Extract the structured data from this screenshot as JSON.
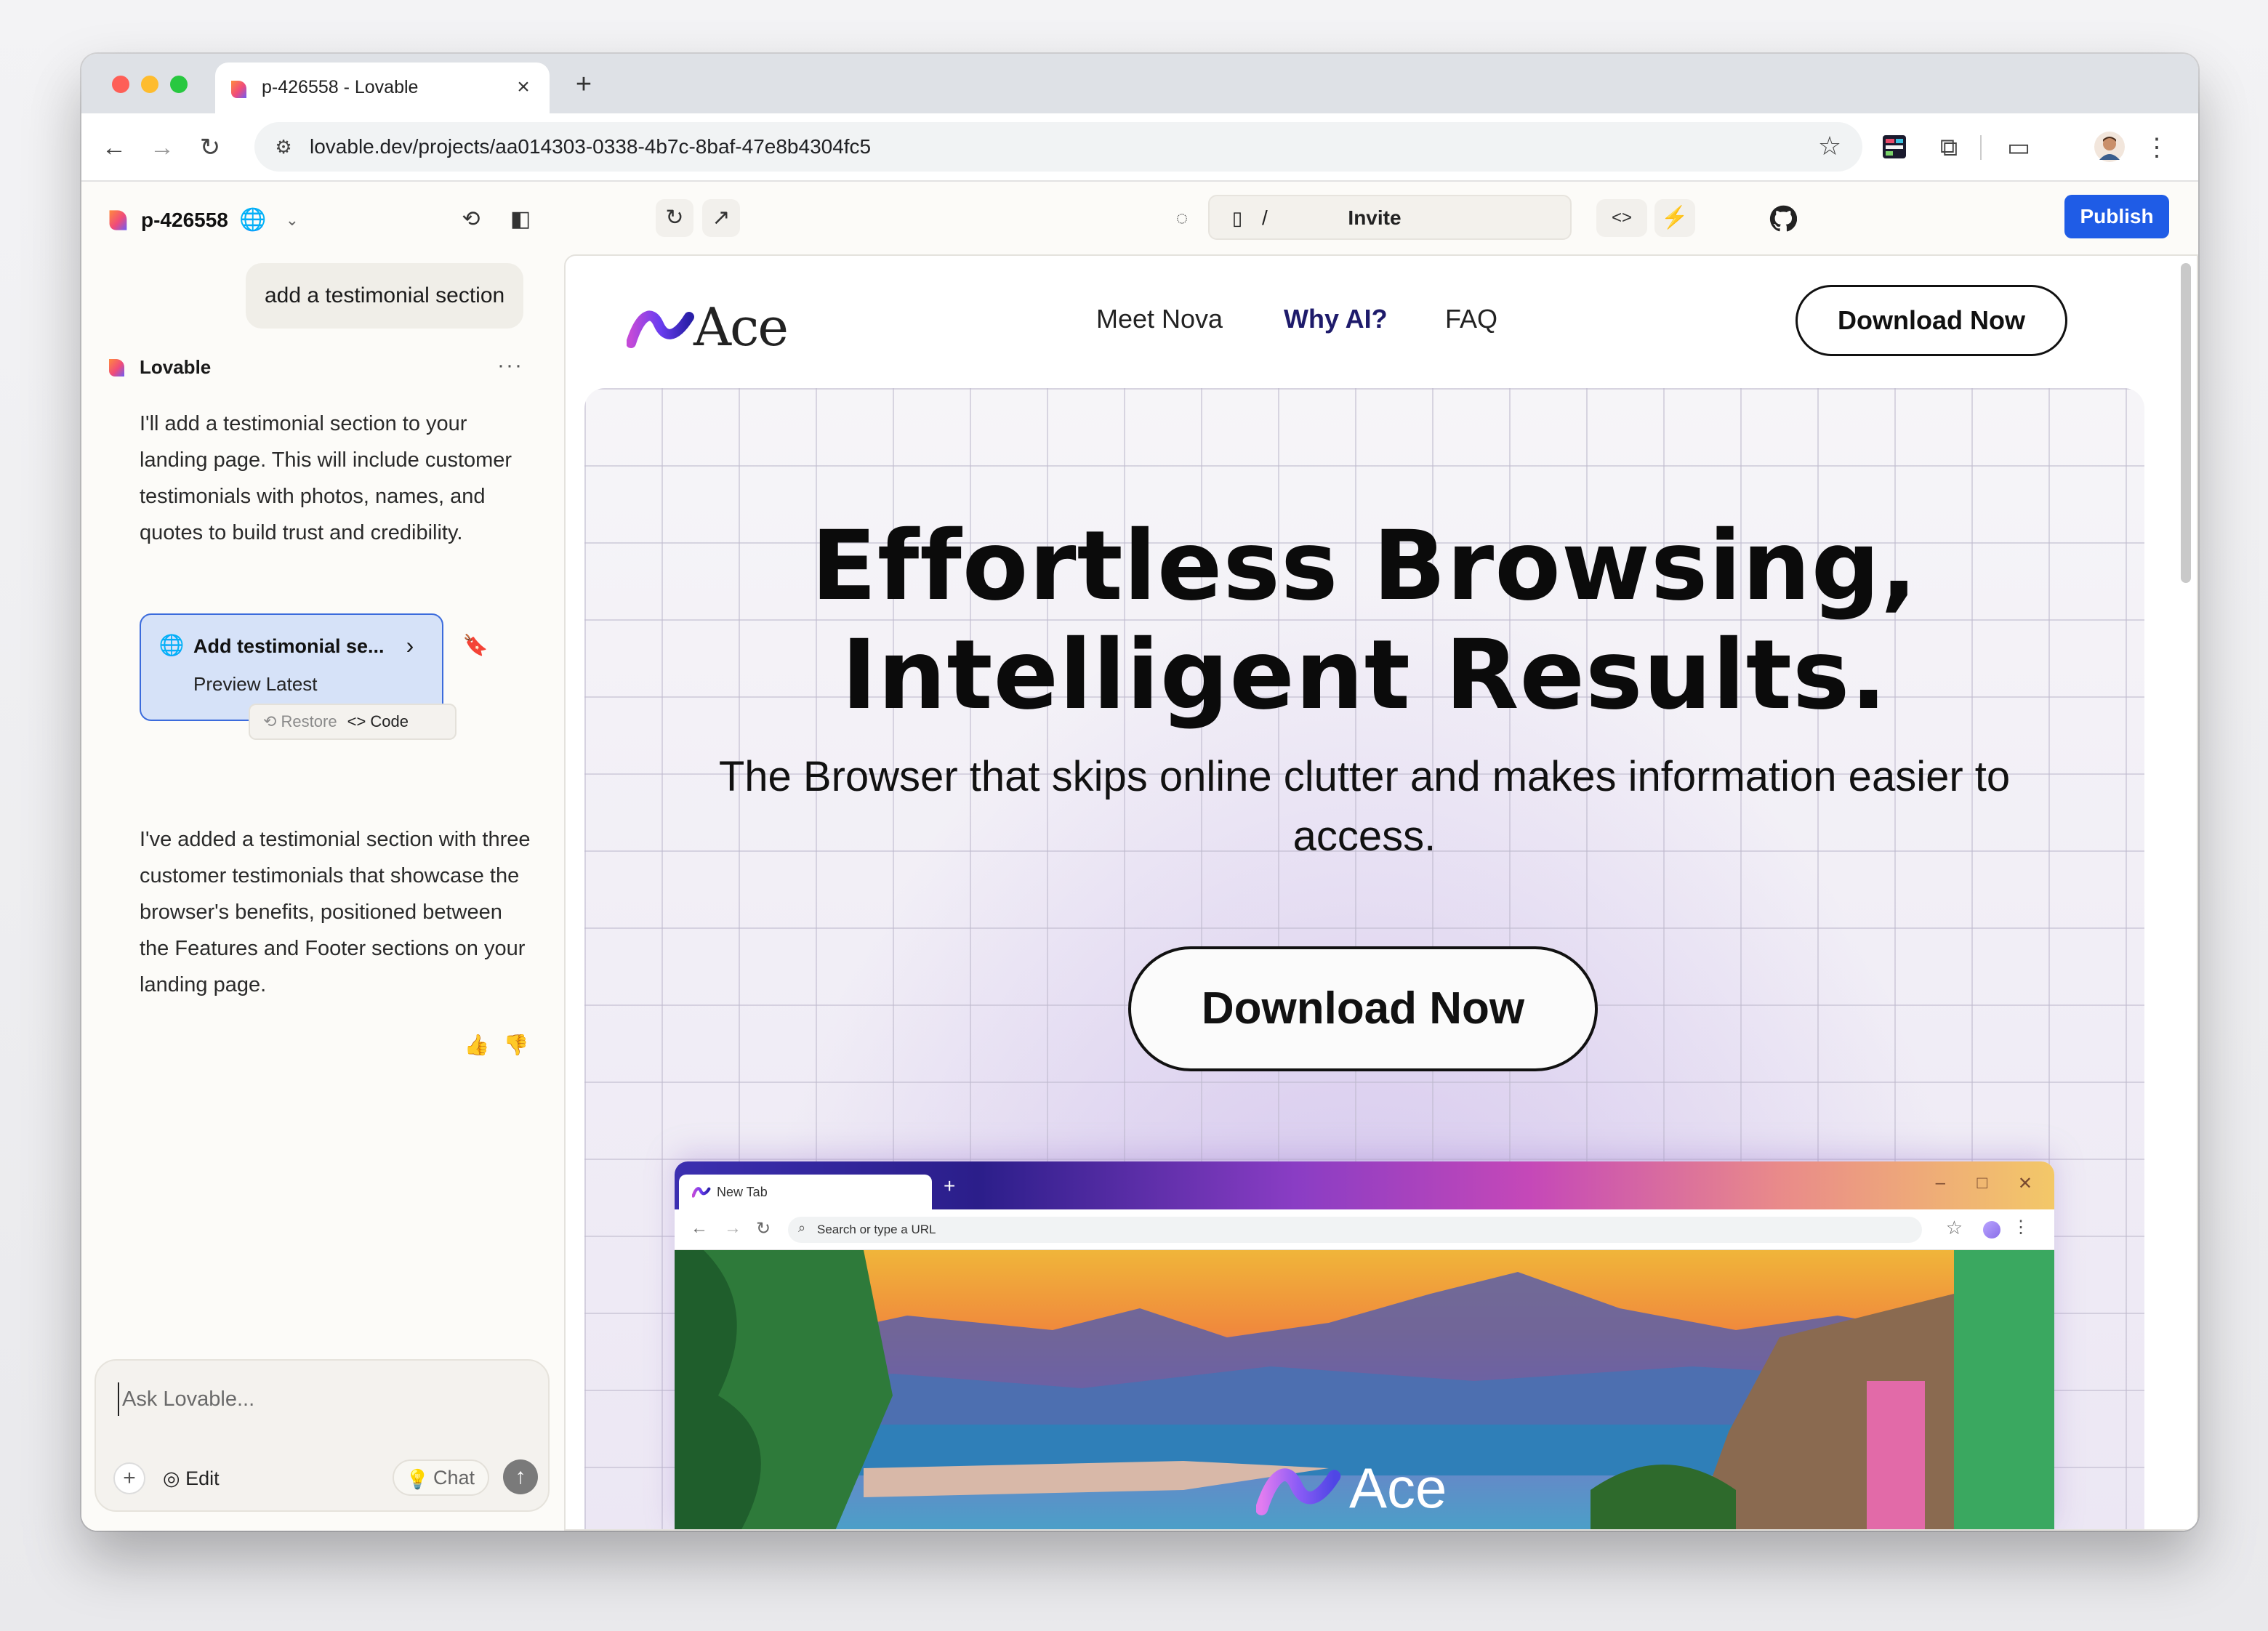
{
  "browser": {
    "tab_title": "p-426558 - Lovable",
    "tab_close": "×",
    "new_tab": "+",
    "url": "lovable.dev/projects/aa014303-0338-4b7c-8baf-47e8b4304fc5",
    "nav": {
      "back": "←",
      "forward": "→",
      "reload": "↻"
    },
    "menu": "⋮",
    "star": "☆"
  },
  "chat": {
    "project_name": "p-426558",
    "user_message": "add a testimonial section",
    "assistant_name": "Lovable",
    "more": "···",
    "reply_1": "I'll add a testimonial section to your landing page. This will include customer testimonials with photos, names, and quotes to build trust and credibility.",
    "version_card": {
      "title": "Add testimonial se...",
      "subtitle": "Preview Latest",
      "restore": "Restore",
      "code": "Code"
    },
    "reply_2": "I've added a testimonial section with three customer testimonials that showcase the browser's benefits, positioned between the Features and Footer sections on your landing page.",
    "composer": {
      "placeholder": "Ask Lovable...",
      "edit": "Edit",
      "chat": "Chat",
      "plus": "+",
      "send": "↑"
    }
  },
  "preview_header": {
    "route": "/",
    "invite": "Invite",
    "publish": "Publish",
    "code_toggle": "<>"
  },
  "site": {
    "logo_text": "Ace",
    "nav_links": [
      "Meet Nova",
      "Why AI?",
      "FAQ"
    ],
    "nav_cta": "Download Now",
    "headline_1": "Effortless Browsing,",
    "headline_2": "Intelligent Results.",
    "subheadline": "The Browser that skips online clutter and makes information easier to access.",
    "hero_cta": "Download Now",
    "mockup": {
      "tab_title": "New Tab",
      "omnibox_placeholder": "Search or type a URL",
      "logo_text": "Ace"
    }
  },
  "colors": {
    "publish": "#1f5ce6",
    "active_nav": "#1e1b6b",
    "version_card_bg": "#d6e2f8",
    "version_card_border": "#3b6bdc"
  }
}
